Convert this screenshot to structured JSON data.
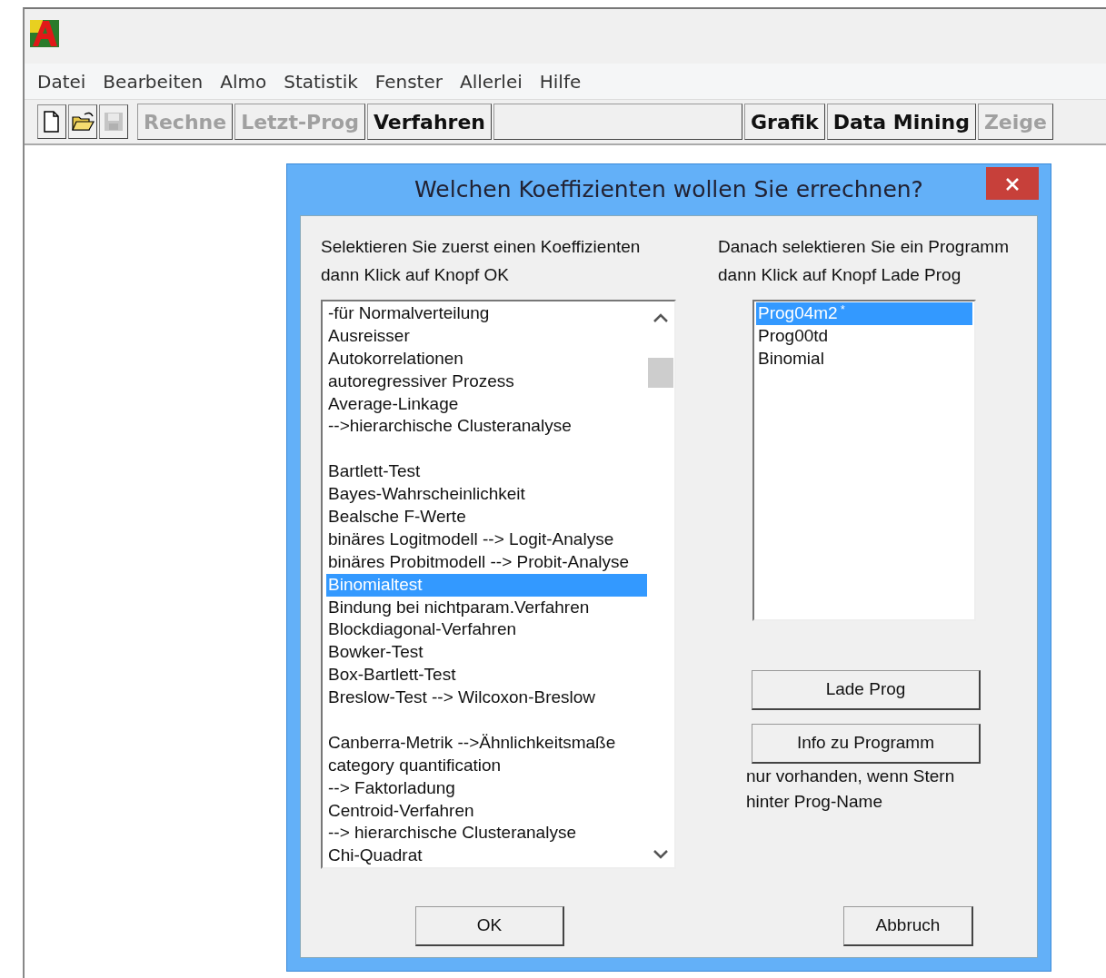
{
  "menu": [
    "Datei",
    "Bearbeiten",
    "Almo",
    "Statistik",
    "Fenster",
    "Allerlei",
    "Hilfe"
  ],
  "toolbar": {
    "icons": [
      {
        "kind": "new",
        "disabled": false
      },
      {
        "kind": "open",
        "disabled": false
      },
      {
        "kind": "save",
        "disabled": true
      }
    ],
    "left_buttons": [
      {
        "label": "Rechne",
        "disabled": true
      },
      {
        "label": "Letzt-Prog",
        "disabled": true
      },
      {
        "label": "Verfahren",
        "disabled": false
      }
    ],
    "right_buttons": [
      {
        "label": "Grafik",
        "disabled": false
      },
      {
        "label": "Data Mining",
        "disabled": false
      },
      {
        "label": "Zeige",
        "disabled": true
      }
    ]
  },
  "dialog": {
    "title": "Welchen Koeffizienten wollen Sie errechnen?",
    "left_instruction": [
      "Selektieren Sie zuerst einen Koeffizienten",
      "dann Klick auf Knopf OK"
    ],
    "coefficients": [
      {
        "kind": "entry",
        "text": "-für Normalverteilung",
        "selected": false
      },
      {
        "kind": "entry",
        "text": "Ausreisser",
        "selected": false
      },
      {
        "kind": "entry",
        "text": "Autokorrelationen",
        "selected": false
      },
      {
        "kind": "entry",
        "text": "autoregressiver Prozess",
        "selected": false
      },
      {
        "kind": "entry",
        "text": "Average-Linkage",
        "selected": false
      },
      {
        "kind": "entry",
        "text": "-->hierarchische Clusteranalyse",
        "selected": false
      },
      {
        "kind": "gap"
      },
      {
        "kind": "entry",
        "text": "Bartlett-Test",
        "selected": false
      },
      {
        "kind": "entry",
        "text": "Bayes-Wahrscheinlichkeit",
        "selected": false
      },
      {
        "kind": "entry",
        "text": "Bealsche F-Werte",
        "selected": false
      },
      {
        "kind": "entry",
        "text": "binäres Logitmodell --> Logit-Analyse",
        "selected": false
      },
      {
        "kind": "entry",
        "text": "binäres Probitmodell --> Probit-Analyse",
        "selected": false
      },
      {
        "kind": "entry",
        "text": "Binomialtest",
        "selected": true
      },
      {
        "kind": "entry",
        "text": "Bindung bei nichtparam.Verfahren",
        "selected": false
      },
      {
        "kind": "entry",
        "text": "Blockdiagonal-Verfahren",
        "selected": false
      },
      {
        "kind": "entry",
        "text": "Bowker-Test",
        "selected": false
      },
      {
        "kind": "entry",
        "text": "Box-Bartlett-Test",
        "selected": false
      },
      {
        "kind": "entry",
        "text": "Breslow-Test --> Wilcoxon-Breslow",
        "selected": false
      },
      {
        "kind": "gap"
      },
      {
        "kind": "entry",
        "text": "Canberra-Metrik -->Ähnlichkeitsmaße",
        "selected": false
      },
      {
        "kind": "entry",
        "text": "category quantification",
        "selected": false
      },
      {
        "kind": "entry",
        "text": "--> Faktorladung",
        "selected": false
      },
      {
        "kind": "entry",
        "text": "Centroid-Verfahren",
        "selected": false
      },
      {
        "kind": "entry",
        "text": "--> hierarchische Clusteranalyse",
        "selected": false
      },
      {
        "kind": "entry",
        "text": "Chi-Quadrat",
        "selected": false
      }
    ],
    "right_instruction": [
      "Danach selektieren Sie ein Programm",
      "dann Klick auf Knopf Lade Prog"
    ],
    "programs": [
      {
        "name": "Prog04m2",
        "mark": "*",
        "selected": true
      },
      {
        "name": "Prog00td",
        "selected": false
      },
      {
        "name": "Binomial",
        "selected": false
      }
    ],
    "load_button": "Lade Prog",
    "info_button": "Info zu Programm",
    "info_note": [
      "nur vorhanden, wenn Stern",
      "hinter Prog-Name"
    ],
    "ok_button": "OK",
    "cancel_button": "Abbruch"
  }
}
